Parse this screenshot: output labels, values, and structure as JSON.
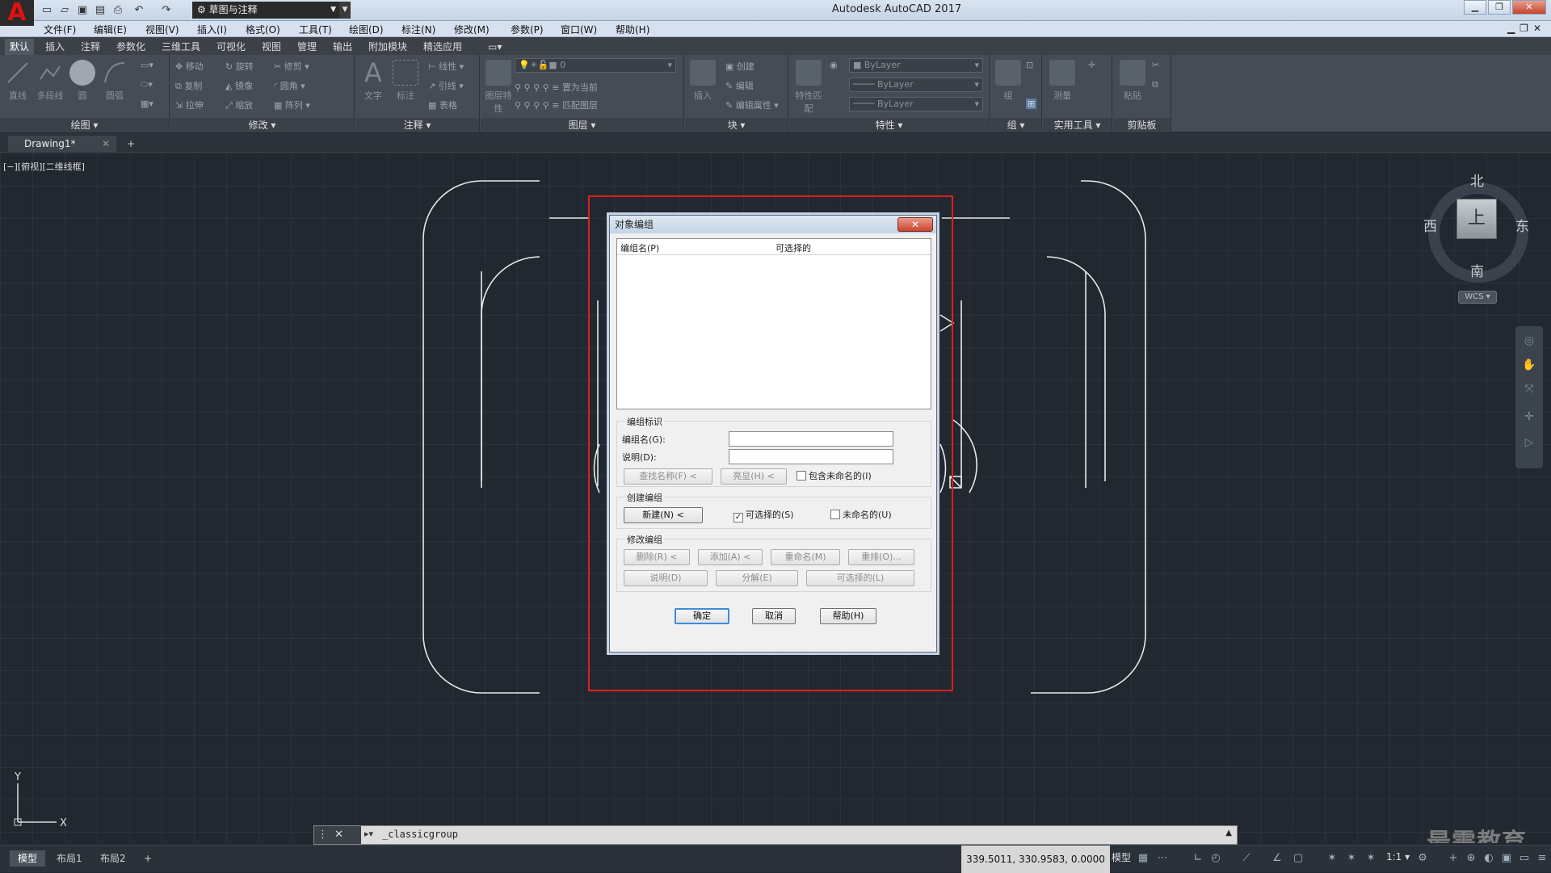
{
  "app": {
    "title": "Autodesk AutoCAD 2017",
    "logo": "A",
    "workspace": "草图与注释"
  },
  "menus": [
    "文件(F)",
    "编辑(E)",
    "视图(V)",
    "插入(I)",
    "格式(O)",
    "工具(T)",
    "绘图(D)",
    "标注(N)",
    "修改(M)",
    "参数(P)",
    "窗口(W)",
    "帮助(H)"
  ],
  "ribbon_tabs": [
    "默认",
    "插入",
    "注释",
    "参数化",
    "三维工具",
    "可视化",
    "视图",
    "管理",
    "输出",
    "附加模块",
    "精选应用"
  ],
  "panels": {
    "draw": {
      "title": "绘图",
      "items": [
        "直线",
        "多段线",
        "圆",
        "圆弧"
      ]
    },
    "modify": {
      "title": "修改",
      "items": [
        "移动",
        "旋转",
        "修剪",
        "复制",
        "镜像",
        "圆角",
        "拉伸",
        "缩放",
        "阵列"
      ]
    },
    "annotate": {
      "title": "注释",
      "items": [
        "文字",
        "标注",
        "线性",
        "引线",
        "表格"
      ]
    },
    "layers": {
      "title": "图层",
      "items": [
        "图层特性",
        "置为当前",
        "匹配图层"
      ],
      "current": "0"
    },
    "block": {
      "title": "块",
      "items": [
        "插入",
        "创建",
        "编辑",
        "编辑属性"
      ]
    },
    "properties": {
      "title": "特性",
      "items": [
        "特性匹配"
      ],
      "color": "ByLayer",
      "linetype": "ByLayer",
      "lineweight": "ByLayer"
    },
    "groups": {
      "title": "组",
      "items": [
        "组"
      ]
    },
    "utilities": {
      "title": "实用工具",
      "items": [
        "测量"
      ]
    },
    "clipboard": {
      "title": "剪贴板",
      "items": [
        "粘贴"
      ]
    }
  },
  "document": {
    "tab": "Drawing1*",
    "view_label": "[−][俯视][二维线框]"
  },
  "dialog": {
    "title": "对象编组",
    "close": "✕",
    "list": {
      "col_name": "编组名(P)",
      "col_selectable": "可选择的"
    },
    "identification": {
      "title": "编组标识",
      "name_label": "编组名(G):",
      "name_value": "",
      "desc_label": "说明(D):",
      "desc_value": "",
      "find_button": "查找名称(F) <",
      "highlight_button": "亮显(H) <",
      "include_unnamed": "包含未命名的(I)"
    },
    "create": {
      "title": "创建编组",
      "new_button": "新建(N) <",
      "selectable": "可选择的(S)",
      "unnamed": "未命名的(U)"
    },
    "change": {
      "title": "修改编组",
      "remove": "删除(R) <",
      "add": "添加(A) <",
      "rename": "重命名(M)",
      "reorder": "重排(O)...",
      "description": "说明(D)",
      "explode": "分解(E)",
      "selectable": "可选择的(L)"
    },
    "ok": "确定",
    "cancel": "取消",
    "help": "帮助(H)"
  },
  "viewcube": {
    "north": "北",
    "south": "南",
    "east": "东",
    "west": "西",
    "top": "上",
    "wcs": "WCS"
  },
  "ucs": {
    "x": "X",
    "y": "Y"
  },
  "command": {
    "text": "_classicgroup"
  },
  "status": {
    "layouts": [
      "模型",
      "布局1",
      "布局2"
    ],
    "coords": "339.5011, 330.9583, 0.0000",
    "model": "模型",
    "scale": "1:1"
  },
  "watermark": "最需教育"
}
